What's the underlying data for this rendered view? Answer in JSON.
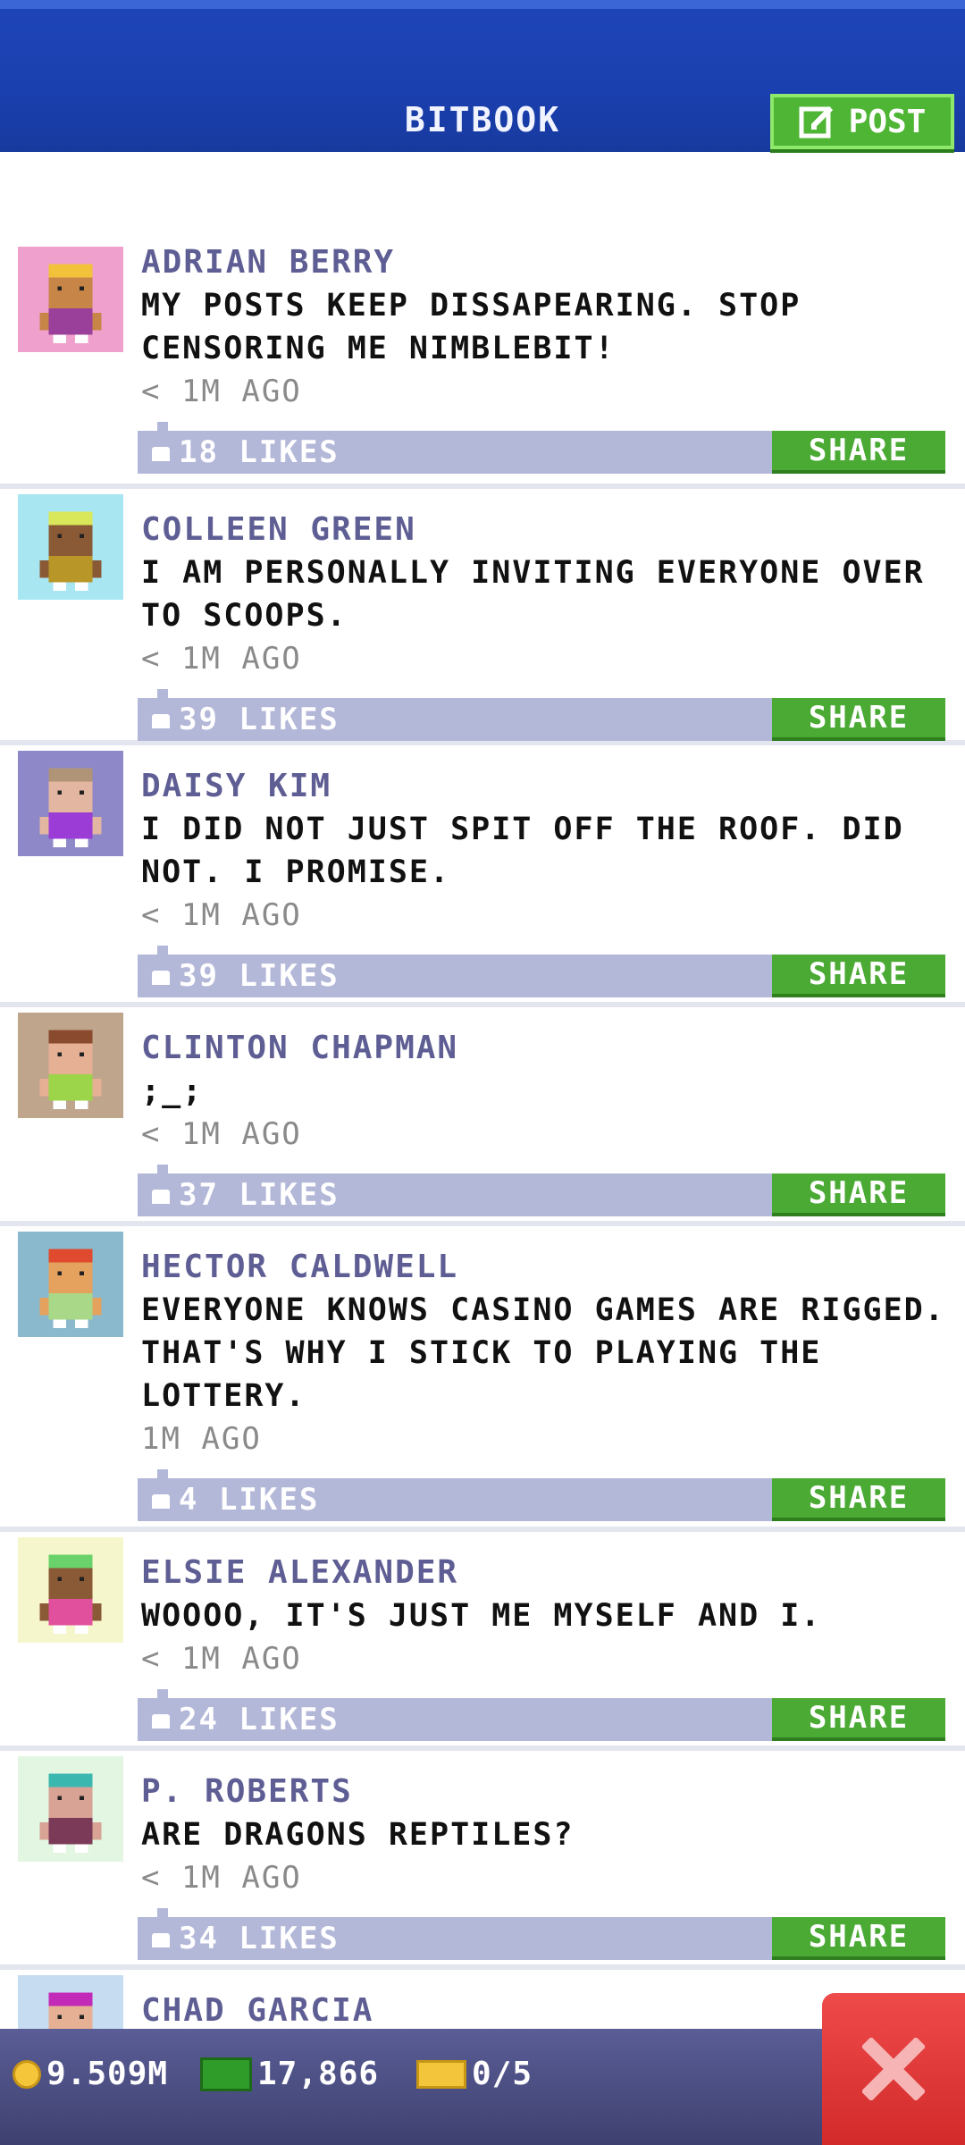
{
  "header": {
    "title": "BITBOOK",
    "post_label": "POST"
  },
  "posts": [
    {
      "name": "ADRIAN BERRY",
      "text": "MY POSTS KEEP DISSAPEARING. STOP CENSORING ME NIMBLEBIT!",
      "time": "< 1M AGO",
      "likes": "18 LIKES",
      "share": "SHARE",
      "avatar_bg": "#f0a0cc",
      "skin": "#c88548",
      "hair": "#f2c23a",
      "shirt": "#9a3f9a"
    },
    {
      "name": "COLLEEN GREEN",
      "text": "I AM PERSONALLY INVITING EVERYONE OVER TO SCOOPS.",
      "time": "< 1M AGO",
      "likes": "39 LIKES",
      "share": "SHARE",
      "avatar_bg": "#a8e6f2",
      "skin": "#8a5a36",
      "hair": "#d8e85a",
      "shirt": "#b89628"
    },
    {
      "name": "DAISY KIM",
      "text": "I DID NOT JUST SPIT OFF THE ROOF. DID NOT. I PROMISE.",
      "time": "< 1M AGO",
      "likes": "39 LIKES",
      "share": "SHARE",
      "avatar_bg": "#8e88c8",
      "skin": "#e2b6a0",
      "hair": "#b09478",
      "shirt": "#9c3cd6"
    },
    {
      "name": "CLINTON CHAPMAN",
      "text": ";_;",
      "time": "< 1M AGO",
      "likes": "37 LIKES",
      "share": "SHARE",
      "avatar_bg": "#bea58c",
      "skin": "#e6b094",
      "hair": "#8a4a2e",
      "shirt": "#9cd44a"
    },
    {
      "name": "HECTOR CALDWELL",
      "text": "EVERYONE KNOWS CASINO GAMES ARE RIGGED. THAT'S WHY I STICK TO PLAYING THE LOTTERY.",
      "time": "1M AGO",
      "likes": "4 LIKES",
      "share": "SHARE",
      "avatar_bg": "#8ab8cc",
      "skin": "#e4a25e",
      "hair": "#e04a2e",
      "shirt": "#a8d888"
    },
    {
      "name": "ELSIE ALEXANDER",
      "text": "WOOOO, IT'S JUST ME MYSELF AND I.",
      "time": "< 1M AGO",
      "likes": "24 LIKES",
      "share": "SHARE",
      "avatar_bg": "#f6f6cc",
      "skin": "#8a5a36",
      "hair": "#6ad26a",
      "shirt": "#e0509c"
    },
    {
      "name": "P. ROBERTS",
      "text": "ARE DRAGONS REPTILES?",
      "time": "< 1M AGO",
      "likes": "34 LIKES",
      "share": "SHARE",
      "avatar_bg": "#e2f6e2",
      "skin": "#d8a294",
      "hair": "#3ab8b0",
      "shirt": "#7a3a58"
    },
    {
      "name": "CHAD GARCIA",
      "text": "",
      "time": "",
      "likes": "",
      "share": "",
      "avatar_bg": "#c6dcf0",
      "skin": "#e6b094",
      "hair": "#c22ab8",
      "shirt": "#333333"
    }
  ],
  "status": {
    "coins": "9.509M",
    "bux": "17,866",
    "tickets": "0/5"
  },
  "colors": {
    "header": "#1a3fae",
    "share": "#4aaa34",
    "likes_bar": "#b3b7d8",
    "close": "#e03a3a"
  }
}
